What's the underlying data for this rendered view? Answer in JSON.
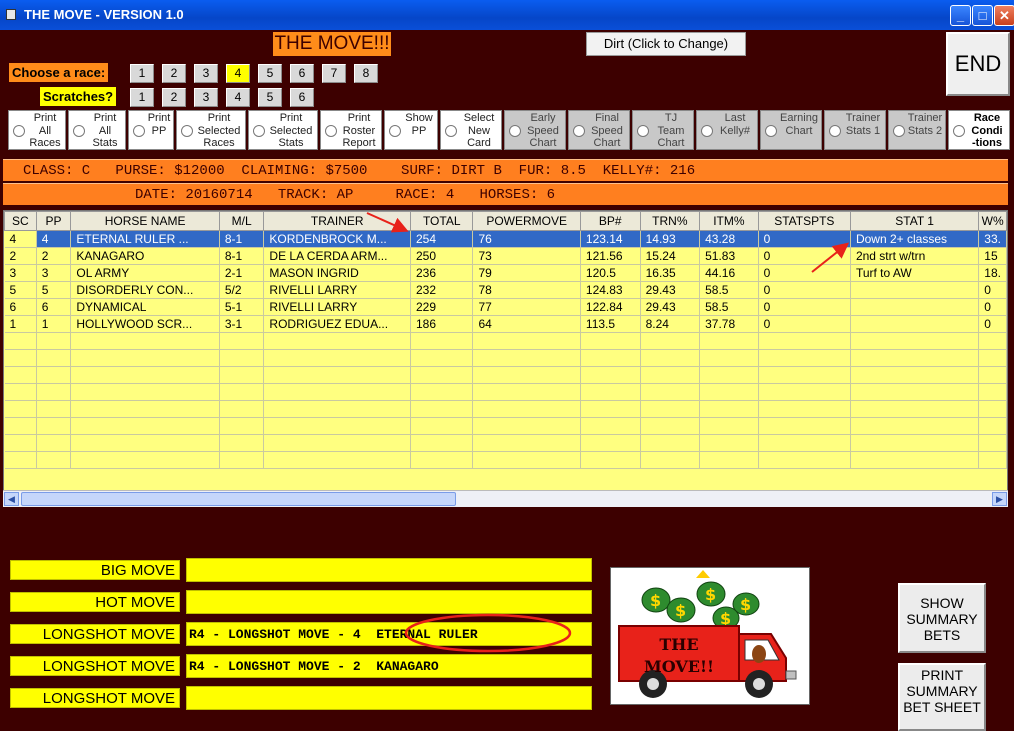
{
  "window": {
    "title": "THE MOVE - VERSION 1.0",
    "minimize": "_",
    "maximize": "□",
    "close": "✕"
  },
  "header": {
    "logo_text": "THE MOVE!!!",
    "surface_button": "Dirt (Click to Change)",
    "end_button": "END"
  },
  "race_chooser": {
    "label": "Choose  a race:",
    "races": [
      "1",
      "2",
      "3",
      "4",
      "5",
      "6",
      "7",
      "8"
    ],
    "selected": "4"
  },
  "scratches": {
    "label": "Scratches?",
    "items": [
      "1",
      "2",
      "3",
      "4",
      "5",
      "6"
    ]
  },
  "options": [
    {
      "label": "Print\nAll\nRaces",
      "style": "white"
    },
    {
      "label": "Print\nAll\nStats",
      "style": "white"
    },
    {
      "label": "Print\nPP",
      "style": "white"
    },
    {
      "label": "Print\nSelected\nRaces",
      "style": "white"
    },
    {
      "label": "Print\nSelected\nStats",
      "style": "white"
    },
    {
      "label": "Print\nRoster\nReport",
      "style": "white"
    },
    {
      "label": "Show\nPP",
      "style": "white"
    },
    {
      "label": "Select\nNew\nCard",
      "style": "white"
    },
    {
      "label": "Early\nSpeed\nChart",
      "style": "gray"
    },
    {
      "label": "Final\nSpeed\nChart",
      "style": "gray"
    },
    {
      "label": "TJ\nTeam\nChart",
      "style": "gray"
    },
    {
      "label": "Last\nKelly#",
      "style": "gray"
    },
    {
      "label": "Earning\nChart",
      "style": "gray"
    },
    {
      "label": "Trainer\nStats 1",
      "style": "gray"
    },
    {
      "label": "Trainer\nStats 2",
      "style": "gray"
    },
    {
      "label": "Race\nCondi\n-tions",
      "style": "bold"
    }
  ],
  "info": {
    "line1": "CLASS: C   PURSE: $12000  CLAIMING: $7500    SURF: DIRT B  FUR: 8.5  KELLY#: 216",
    "line2": "DATE: 20160714   TRACK: AP     RACE: 4   HORSES: 6"
  },
  "grid": {
    "columns": [
      "SC",
      "PP",
      "HORSE NAME",
      "M/L",
      "TRAINER",
      "TOTAL",
      "POWERMOVE",
      "BP#",
      "TRN%",
      "ITM%",
      "STATSPTS",
      "STAT 1",
      "W%"
    ],
    "rows": [
      [
        "4",
        "4",
        "ETERNAL RULER ...",
        "8-1",
        "KORDENBROCK M...",
        "254",
        "76",
        "123.14",
        "14.93",
        "43.28",
        "0",
        "Down 2+ classes",
        "33."
      ],
      [
        "2",
        "2",
        "KANAGARO",
        "8-1",
        "DE LA CERDA ARM...",
        "250",
        "73",
        "121.56",
        "15.24",
        "51.83",
        "0",
        "2nd strt w/trn",
        "15"
      ],
      [
        "3",
        "3",
        "OL ARMY",
        "2-1",
        "MASON INGRID",
        "236",
        "79",
        "120.5",
        "16.35",
        "44.16",
        "0",
        "Turf to AW",
        "18."
      ],
      [
        "5",
        "5",
        "DISORDERLY CON...",
        "5/2",
        "RIVELLI LARRY",
        "232",
        "78",
        "124.83",
        "29.43",
        "58.5",
        "0",
        "",
        "0"
      ],
      [
        "6",
        "6",
        "DYNAMICAL",
        "5-1",
        "RIVELLI LARRY",
        "229",
        "77",
        "122.84",
        "29.43",
        "58.5",
        "0",
        "",
        "0"
      ],
      [
        "1",
        "1",
        "HOLLYWOOD SCR...",
        "3-1",
        "RODRIGUEZ EDUA...",
        "186",
        "64",
        "113.5",
        "8.24",
        "37.78",
        "0",
        "",
        "0"
      ]
    ],
    "empty_rows": 8,
    "selected_row": 0
  },
  "moves": [
    {
      "label": "BIG MOVE",
      "value": ""
    },
    {
      "label": "HOT MOVE",
      "value": ""
    },
    {
      "label": "LONGSHOT MOVE",
      "value": "R4 - LONGSHOT MOVE - 4  ETERNAL RULER"
    },
    {
      "label": "LONGSHOT MOVE",
      "value": "R4 - LONGSHOT MOVE - 2  KANAGARO"
    },
    {
      "label": "LONGSHOT MOVE",
      "value": ""
    }
  ],
  "truck": {
    "text": "THE\nMOVE!!"
  },
  "buttons": {
    "show_summary": "SHOW SUMMARY BETS",
    "print_summary": "PRINT SUMMARY BET SHEET"
  },
  "colors": {
    "background": "#3d0000",
    "accent_orange": "#ff8c1a",
    "highlight_yellow": "#ffff00",
    "grid_yellow": "#ffff80",
    "selection_blue": "#3169c6",
    "annotation_red": "#e8221a"
  }
}
